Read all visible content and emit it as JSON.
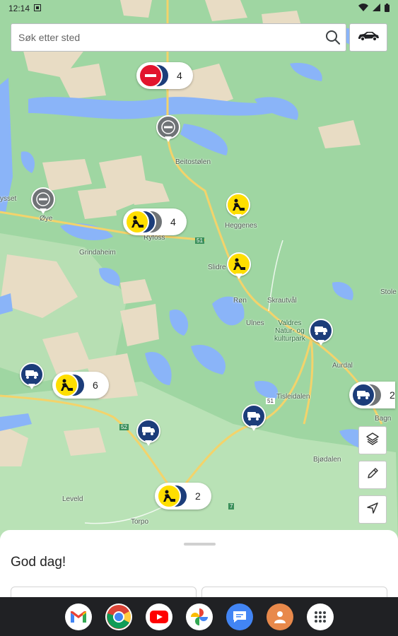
{
  "status_bar": {
    "time": "12:14"
  },
  "search": {
    "placeholder": "Søk etter sted"
  },
  "map": {
    "places": [
      {
        "id": "beitostolen",
        "name": "Beitostølen"
      },
      {
        "id": "ryfoss",
        "name": "Ryfoss"
      },
      {
        "id": "heggenes",
        "name": "Heggenes"
      },
      {
        "id": "slidre",
        "name": "Slidre"
      },
      {
        "id": "grindaheim",
        "name": "Grindaheim"
      },
      {
        "id": "oye",
        "name": "Øye"
      },
      {
        "id": "rysset",
        "name": "ysset"
      },
      {
        "id": "ron",
        "name": "Røn"
      },
      {
        "id": "skrautval",
        "name": "Skrautvål"
      },
      {
        "id": "ulnes",
        "name": "Ulnes"
      },
      {
        "id": "valdres",
        "name": "Valdres\nNatur- og\nkulturpark"
      },
      {
        "id": "aurdal",
        "name": "Aurdal"
      },
      {
        "id": "tisleidalen",
        "name": "Tisleidalen"
      },
      {
        "id": "bagn",
        "name": "Bagn"
      },
      {
        "id": "bjodalen",
        "name": "Bjødalen"
      },
      {
        "id": "leveld",
        "name": "Leveld"
      },
      {
        "id": "torpo",
        "name": "Torpo"
      },
      {
        "id": "stole",
        "name": "Stole"
      }
    ],
    "road_numbers": [
      "51",
      "51",
      "52",
      "7"
    ],
    "clusters": [
      {
        "id": "cluster-top",
        "count": "4"
      },
      {
        "id": "cluster-ryfoss",
        "count": "4"
      },
      {
        "id": "cluster-west",
        "count": "6"
      },
      {
        "id": "cluster-torpo",
        "count": "2"
      },
      {
        "id": "cluster-bagn",
        "count": "2"
      }
    ]
  },
  "sheet": {
    "greeting": "God dag!"
  },
  "colors": {
    "roadwork": "#ffde00",
    "closed": "#e2142d",
    "queue": "#1c3d7a",
    "info": "#6f7376",
    "map_green": "#9fd6a2",
    "water": "#8ab4f8"
  },
  "icons": [
    "search-icon",
    "car-icon",
    "layers-icon",
    "pencil-icon",
    "navigation-icon",
    "roadwork-icon",
    "no-entry-icon",
    "traffic-queue-icon",
    "gmail-icon",
    "chrome-icon",
    "youtube-icon",
    "photos-icon",
    "messages-icon",
    "app-icon",
    "app-drawer-icon"
  ]
}
